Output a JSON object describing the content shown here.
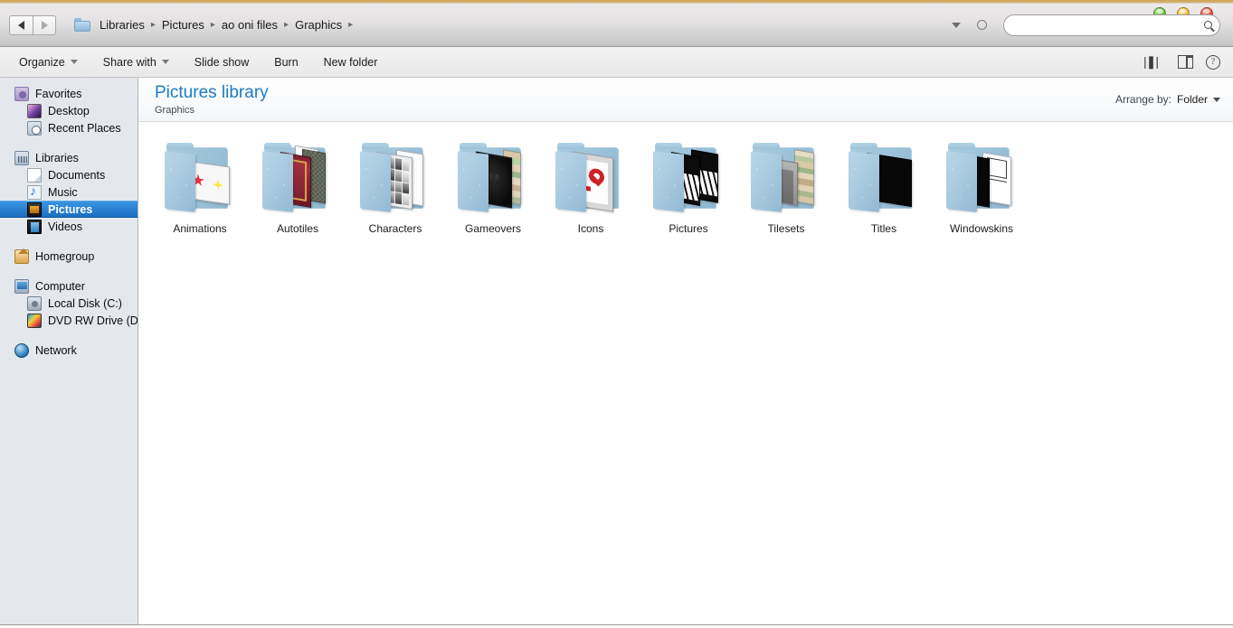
{
  "window": {
    "controls": [
      {
        "name": "minimize",
        "color": "#63c036"
      },
      {
        "name": "maximize",
        "color": "#f0b324"
      },
      {
        "name": "close",
        "color": "#e04a3a"
      }
    ]
  },
  "address_bar": {
    "back_label": "Back",
    "forward_label": "Forward",
    "folder_icon": "folder-icon",
    "breadcrumbs": [
      "Libraries",
      "Pictures",
      "ao oni files",
      "Graphics"
    ],
    "separator": "▸",
    "history_dropdown": "chevron-down-icon",
    "refresh": "refresh-icon"
  },
  "search": {
    "value": "",
    "placeholder": "",
    "icon": "search-icon"
  },
  "command_bar": {
    "items": [
      {
        "label": "Organize",
        "has_caret": true
      },
      {
        "label": "Share with",
        "has_caret": true
      },
      {
        "label": "Slide show",
        "has_caret": false
      },
      {
        "label": "Burn",
        "has_caret": false
      },
      {
        "label": "New folder",
        "has_caret": false
      }
    ],
    "right_icons": [
      {
        "name": "change-view-icon",
        "caret": true
      },
      {
        "name": "preview-pane-icon",
        "caret": false
      },
      {
        "name": "help-icon",
        "caret": false
      }
    ],
    "help_glyph": "?"
  },
  "navigation_pane": {
    "groups": [
      {
        "header": {
          "label": "Favorites",
          "icon": "favorites-icon"
        },
        "children": [
          {
            "label": "Desktop",
            "icon": "desktop-icon"
          },
          {
            "label": "Recent Places",
            "icon": "recent-places-icon"
          }
        ]
      },
      {
        "header": {
          "label": "Libraries",
          "icon": "libraries-icon"
        },
        "children": [
          {
            "label": "Documents",
            "icon": "documents-icon",
            "selected": false
          },
          {
            "label": "Music",
            "icon": "music-icon",
            "selected": false
          },
          {
            "label": "Pictures",
            "icon": "pictures-icon",
            "selected": true
          },
          {
            "label": "Videos",
            "icon": "videos-icon",
            "selected": false
          }
        ]
      },
      {
        "header": {
          "label": "Homegroup",
          "icon": "homegroup-icon"
        },
        "children": []
      },
      {
        "header": {
          "label": "Computer",
          "icon": "computer-icon"
        },
        "children": [
          {
            "label": "Local Disk (C:)",
            "icon": "local-disk-icon"
          },
          {
            "label": "DVD RW Drive (D:) R",
            "icon": "dvd-drive-icon"
          }
        ]
      },
      {
        "header": {
          "label": "Network",
          "icon": "network-icon"
        },
        "children": []
      }
    ]
  },
  "library_header": {
    "title": "Pictures library",
    "subtitle": "Graphics",
    "arrange_label": "Arrange by:",
    "arrange_value": "Folder"
  },
  "folders": [
    {
      "label": "Animations"
    },
    {
      "label": "Autotiles"
    },
    {
      "label": "Characters"
    },
    {
      "label": "Gameovers"
    },
    {
      "label": "Icons"
    },
    {
      "label": "Pictures"
    },
    {
      "label": "Tilesets"
    },
    {
      "label": "Titles"
    },
    {
      "label": "Windowskins"
    }
  ],
  "colors": {
    "accent_title": "#1c7bc4",
    "selection": "#1c6fc4",
    "navpane_bg": "#e4e8ed",
    "content_bg": "#ffffff",
    "window_edge": "#c9a557"
  }
}
